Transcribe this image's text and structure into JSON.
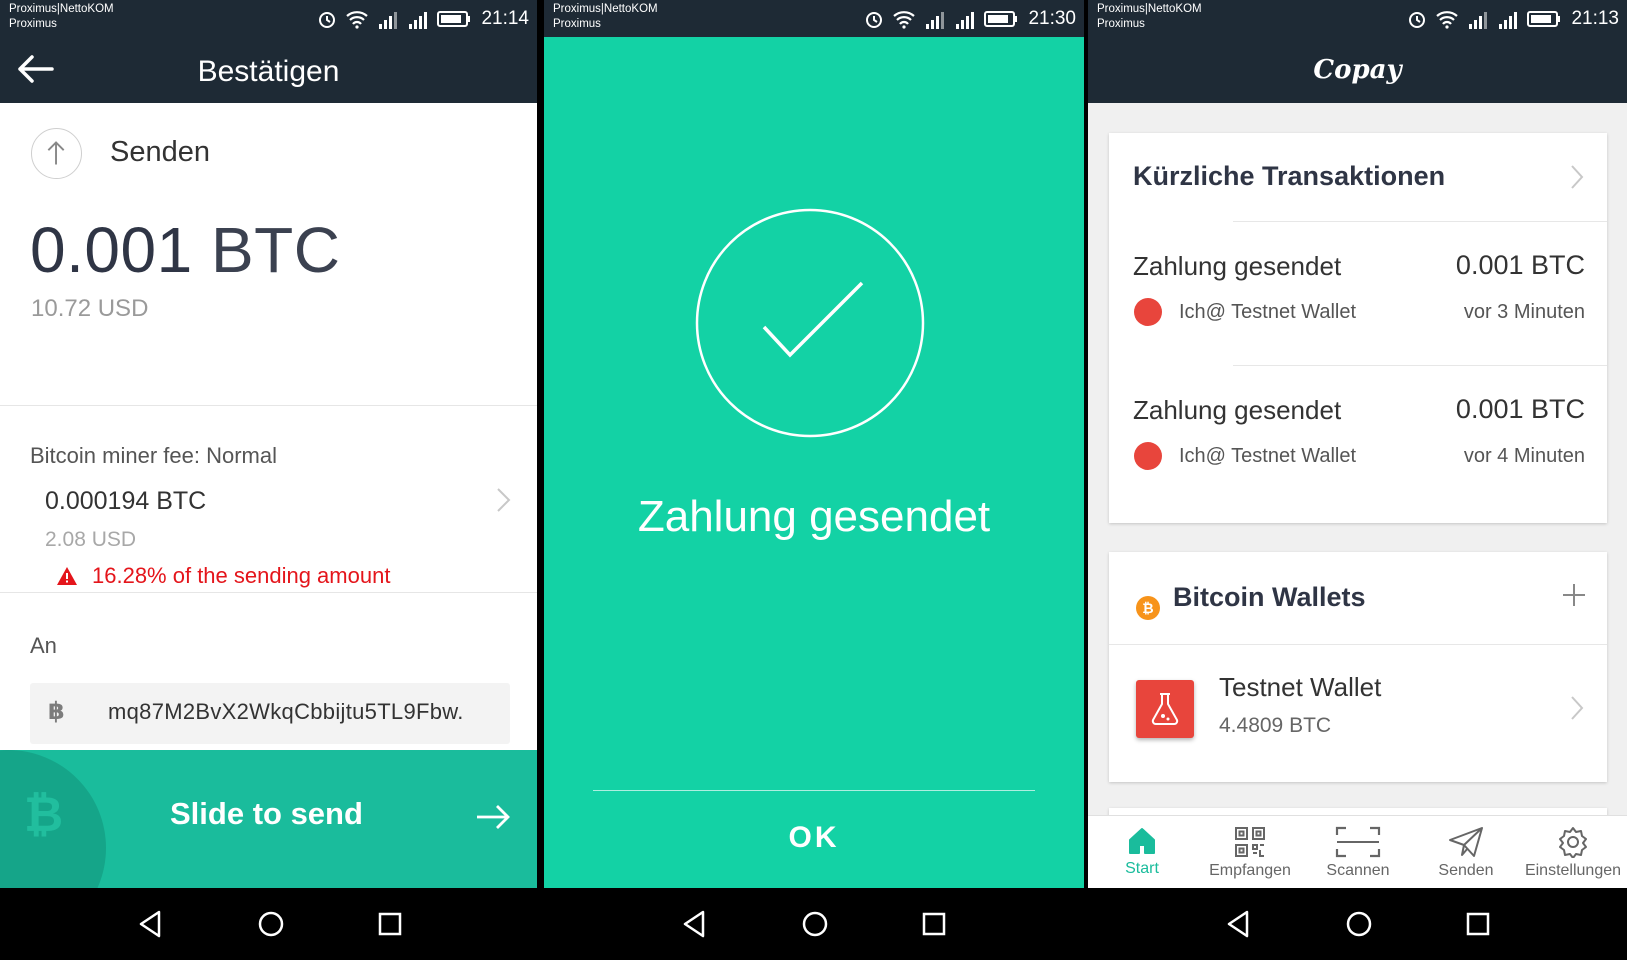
{
  "status_bars": [
    {
      "carrier_line1": "Proximus|NettoKOM",
      "carrier_line2": "Proximus",
      "time": "21:14"
    },
    {
      "carrier_line1": "Proximus|NettoKOM",
      "carrier_line2": "Proximus",
      "time": "21:30"
    },
    {
      "carrier_line1": "Proximus|NettoKOM",
      "carrier_line2": "Proximus",
      "time": "21:13"
    }
  ],
  "confirm": {
    "title": "Bestätigen",
    "send_label": "Senden",
    "amount_value": "0.001",
    "amount_unit": "BTC",
    "amount_fiat": "10.72 USD",
    "fee_label": "Bitcoin miner fee: Normal",
    "fee_btc": "0.000194 BTC",
    "fee_usd": "2.08 USD",
    "fee_warning": "16.28% of the sending amount",
    "to_label": "An",
    "address_symbol": "฿",
    "address": "mq87M2BvX2WkqCbbijtu5TL9Fbw.",
    "slide_label": "Slide to send",
    "slider_symbol": "₿"
  },
  "success": {
    "message": "Zahlung gesendet",
    "ok_label": "OK"
  },
  "home": {
    "logo": "Copay",
    "recent_title": "Kürzliche Transaktionen",
    "transactions": [
      {
        "title": "Zahlung gesendet",
        "amount": "0.001 BTC",
        "wallet": "Ich@ Testnet Wallet",
        "time": "vor 3 Minuten"
      },
      {
        "title": "Zahlung gesendet",
        "amount": "0.001 BTC",
        "wallet": "Ich@ Testnet Wallet",
        "time": "vor 4 Minuten"
      }
    ],
    "wallets_title": "Bitcoin Wallets",
    "coin_symbol": "₿",
    "wallet": {
      "name": "Testnet Wallet",
      "balance": "4.4809 BTC"
    },
    "tabs": [
      {
        "label": "Start",
        "icon": "home-icon",
        "active": true
      },
      {
        "label": "Empfangen",
        "icon": "qr-code-icon"
      },
      {
        "label": "Scannen",
        "icon": "scan-icon"
      },
      {
        "label": "Senden",
        "icon": "paper-plane-icon"
      },
      {
        "label": "Einstellungen",
        "icon": "gear-icon"
      }
    ]
  },
  "colors": {
    "appbar": "#1e2a35",
    "accent": "#1abc9c",
    "success_bg": "#13d2a5",
    "warning": "#e4151b",
    "tx_dot": "#e8453c",
    "bitcoin": "#f7931a"
  }
}
